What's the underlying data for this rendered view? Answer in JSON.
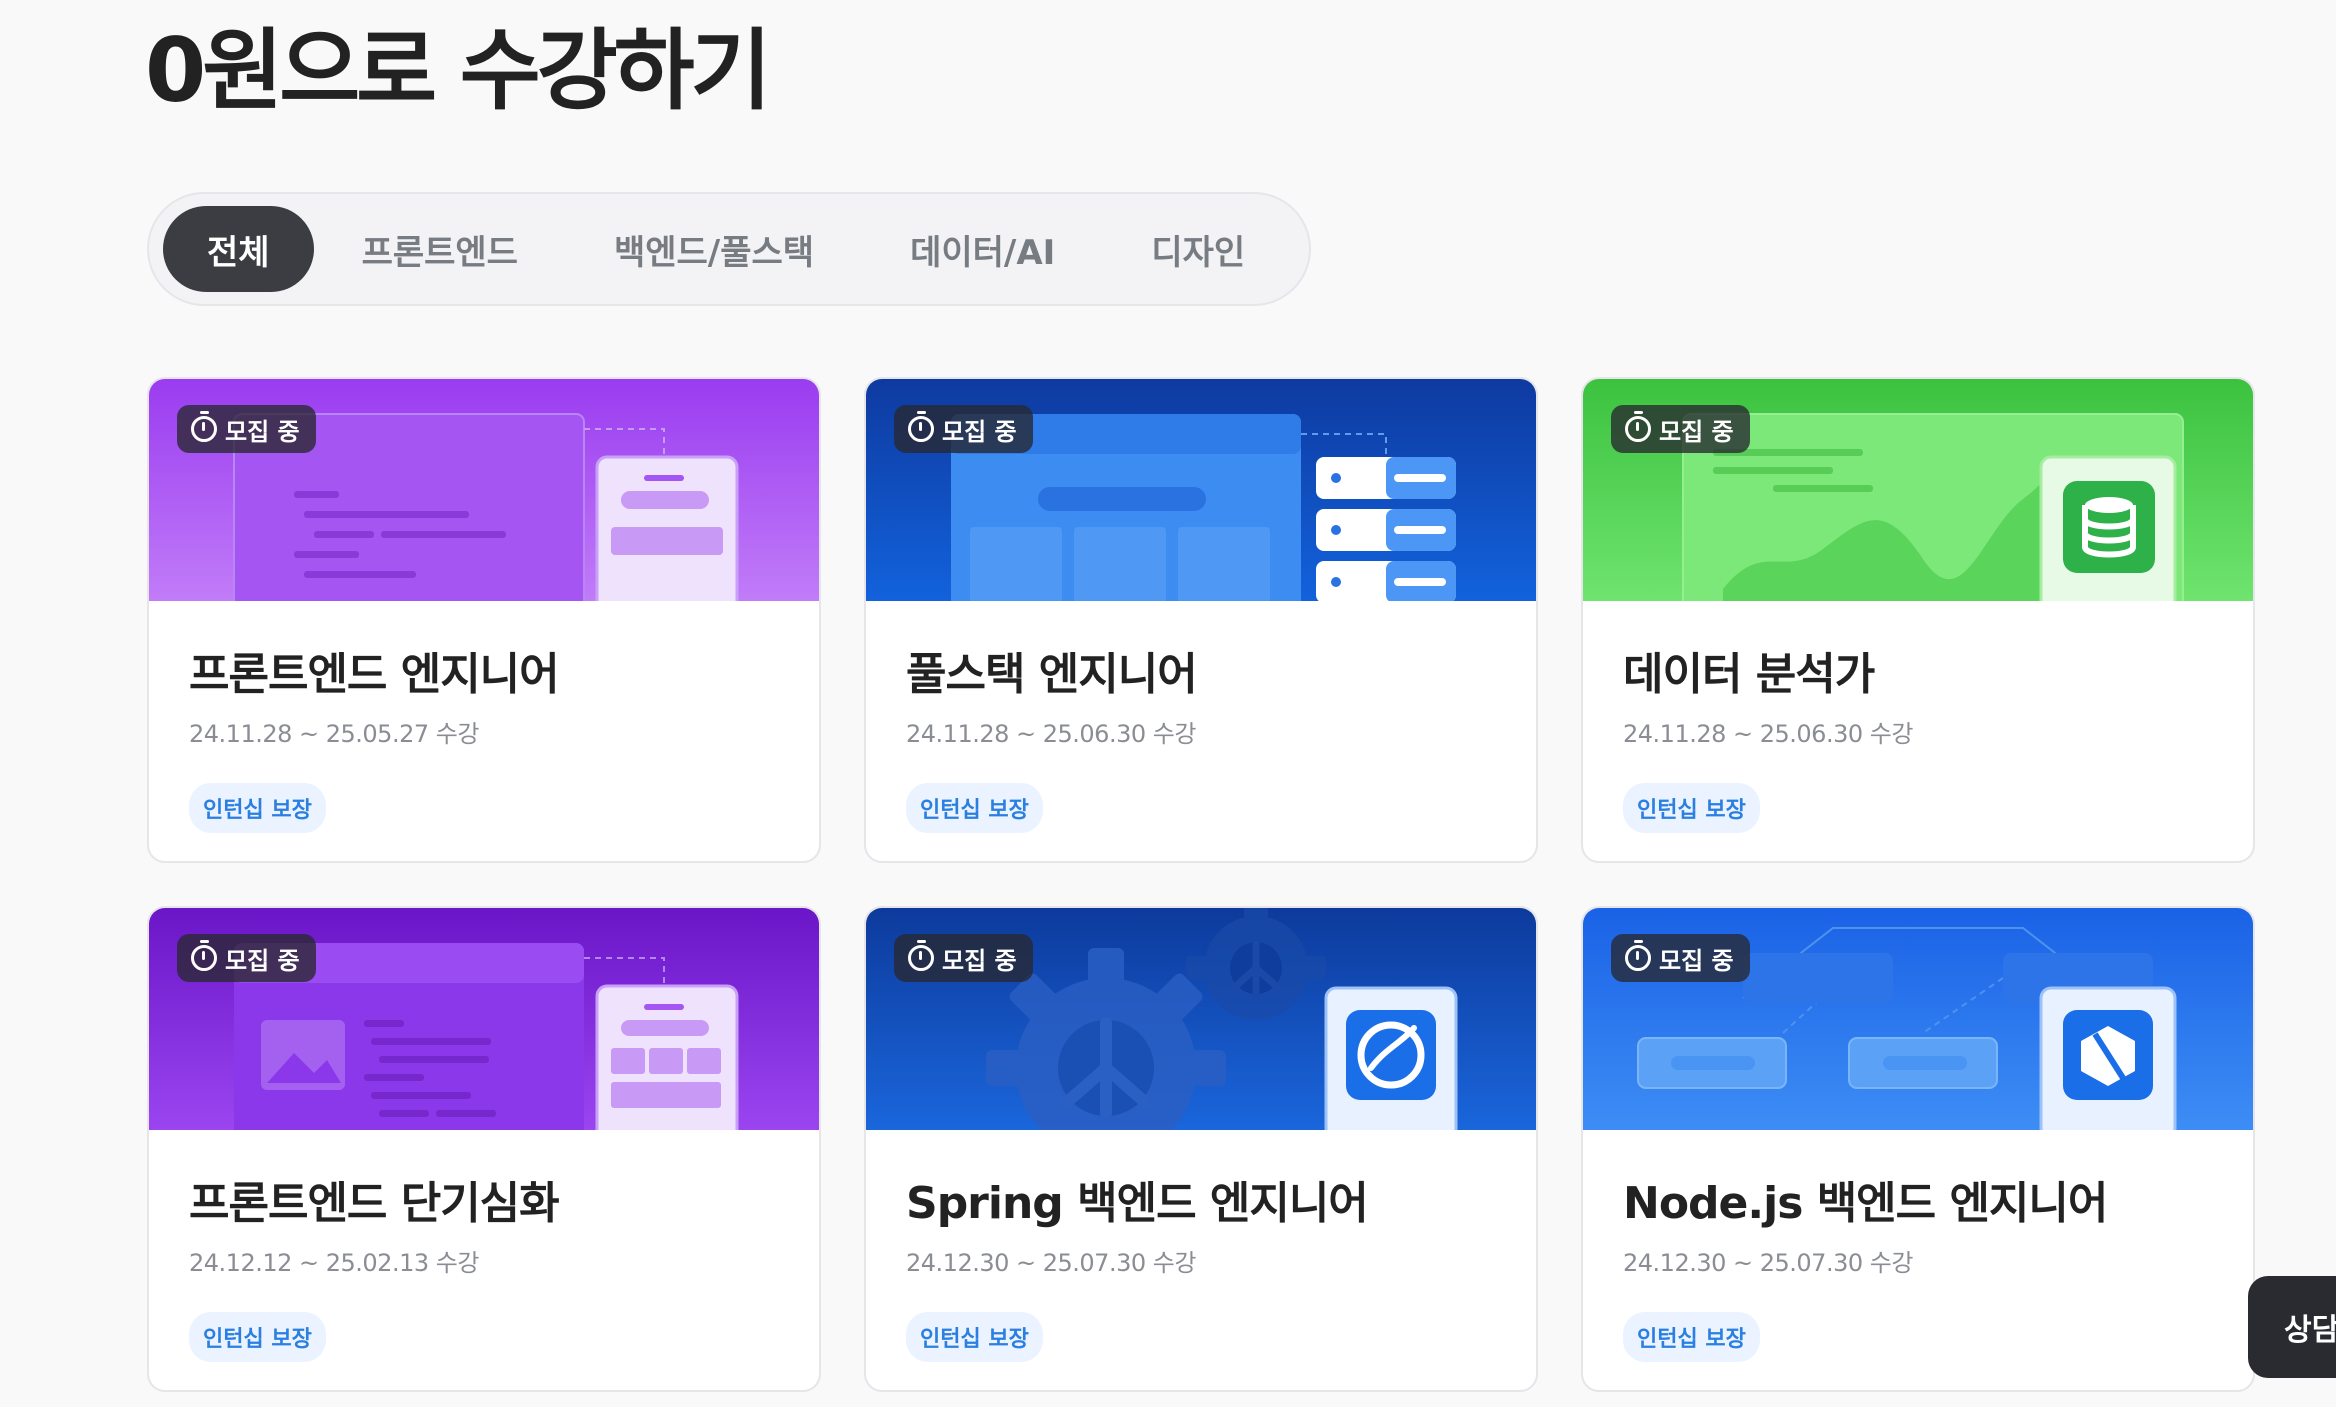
{
  "title": "0원으로 수강하기",
  "tabs": [
    {
      "label": "전체",
      "active": true
    },
    {
      "label": "프론트엔드",
      "active": false
    },
    {
      "label": "백엔드/풀스택",
      "active": false
    },
    {
      "label": "데이터/AI",
      "active": false
    },
    {
      "label": "디자인",
      "active": false
    }
  ],
  "cards": [
    {
      "badge": "모집 중",
      "title": "프론트엔드 엔지니어",
      "date": "24.11.28 ~ 25.05.27 수강",
      "chip": "인턴십 보장",
      "theme": "purple",
      "icon": "web-mockup-icon"
    },
    {
      "badge": "모집 중",
      "title": "풀스택 엔지니어",
      "date": "24.11.28 ~ 25.06.30 수강",
      "chip": "인턴십 보장",
      "theme": "blue",
      "icon": "server-stack-icon"
    },
    {
      "badge": "모집 중",
      "title": "데이터 분석가",
      "date": "24.11.28 ~ 25.06.30 수강",
      "chip": "인턴십 보장",
      "theme": "green",
      "icon": "database-icon"
    },
    {
      "badge": "모집 중",
      "title": "프론트엔드 단기심화",
      "date": "24.12.12 ~ 25.02.13 수강",
      "chip": "인턴십 보장",
      "theme": "purple",
      "icon": "web-mockup-icon"
    },
    {
      "badge": "모집 중",
      "title": "Spring 백엔드 엔지니어",
      "date": "24.12.30 ~ 25.07.30 수강",
      "chip": "인턴십 보장",
      "theme": "blue",
      "icon": "spring-logo-icon"
    },
    {
      "badge": "모집 중",
      "title": "Node.js 백엔드 엔지니어",
      "date": "24.12.30 ~ 25.07.30 수강",
      "chip": "인턴십 보장",
      "theme": "blue",
      "icon": "nodejs-logo-icon"
    }
  ],
  "floating_button": {
    "label": "상담"
  },
  "colors": {
    "purple": "#9b3ff2",
    "blue": "#1f6fe6",
    "green": "#4fd15e",
    "chip_text": "#2b7fe0",
    "active_tab": "#3c3d42"
  }
}
